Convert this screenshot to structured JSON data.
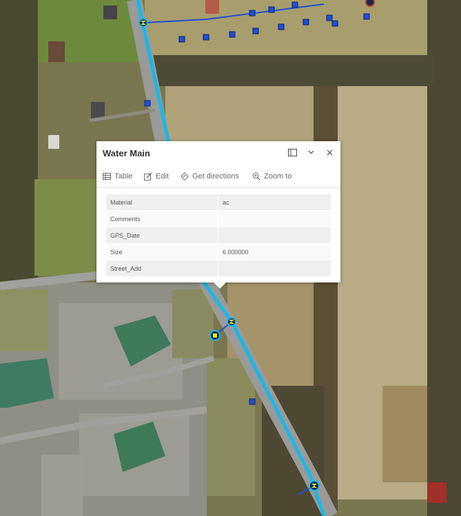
{
  "popup": {
    "title": "Water Main",
    "actions": {
      "table": "Table",
      "edit": "Edit",
      "directions": "Get directions",
      "zoom": "Zoom to"
    },
    "attributes": [
      {
        "field": "Material",
        "value": "ac"
      },
      {
        "field": "Comments",
        "value": ""
      },
      {
        "field": "GPS_Date",
        "value": ""
      },
      {
        "field": "Size",
        "value": "6.000000"
      },
      {
        "field": "Street_Add",
        "value": ""
      }
    ]
  },
  "colors": {
    "water_main_line": "#19b8e8",
    "service_point": "#1c4fd6",
    "valve_marker": "#f2e51d",
    "popup_bg": "#ffffff"
  },
  "map_layers": {
    "basemap": "imagery",
    "features": [
      "water-main-line",
      "service-point-icon",
      "valve-icon",
      "hydrant-icon"
    ]
  }
}
